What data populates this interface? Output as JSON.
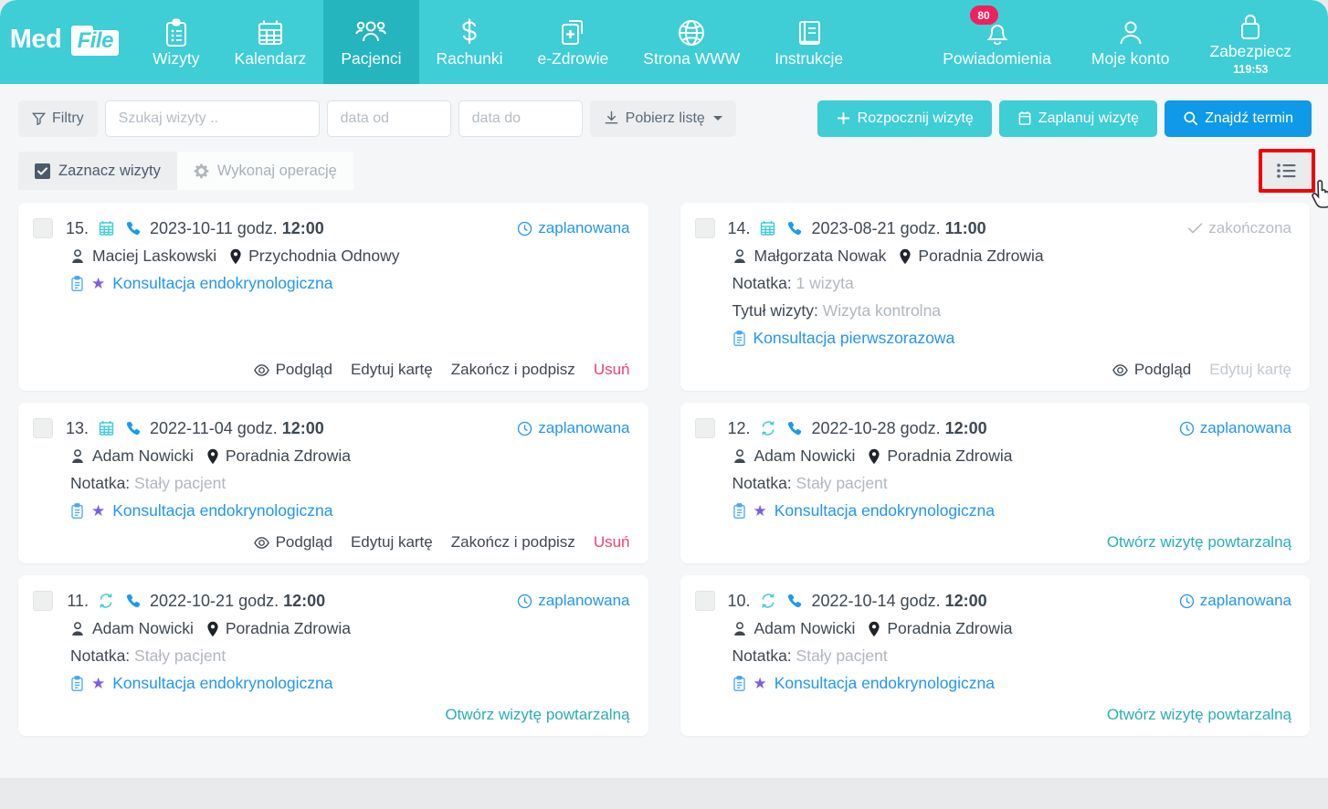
{
  "brand": {
    "med": "Med",
    "file": "File",
    "color": "#3fcdd6"
  },
  "nav": {
    "items": [
      {
        "label": "Wizyty",
        "icon": "clipboard-icon",
        "active": false
      },
      {
        "label": "Kalendarz",
        "icon": "calendar-icon",
        "active": false
      },
      {
        "label": "Pacjenci",
        "icon": "users-icon",
        "active": true
      },
      {
        "label": "Rachunki",
        "icon": "dollar-icon",
        "active": false
      },
      {
        "label": "e-Zdrowie",
        "icon": "medical-file-icon",
        "active": false
      },
      {
        "label": "Strona WWW",
        "icon": "globe-icon",
        "active": false
      },
      {
        "label": "Instrukcje",
        "icon": "book-icon",
        "active": false
      }
    ]
  },
  "header_right": {
    "notifications": {
      "label": "Powiadomienia",
      "icon": "bell-icon",
      "badge": "80",
      "badge_color": "#f01f5e"
    },
    "account": {
      "label": "Moje konto",
      "icon": "user-icon"
    },
    "secure": {
      "label": "Zabezpiecz",
      "icon": "lock-icon",
      "timer": "119:53"
    }
  },
  "toolbar": {
    "filters_label": "Filtry",
    "search_placeholder": "Szukaj wizyty ..",
    "search_value": "",
    "date_from_placeholder": "data od",
    "date_from_value": "",
    "date_to_placeholder": "data do",
    "date_to_value": "",
    "download_label": "Pobierz listę",
    "start_visit_label": "Rozpocznij wizytę",
    "plan_visit_label": "Zaplanuj wizytę",
    "find_slot_label": "Znajdź termin"
  },
  "toolbar2": {
    "select_visits_label": "Zaznacz wizyty",
    "run_operation_label": "Wykonaj operację",
    "view_toggle_icon": "list-view-icon",
    "view_toggle_highlight_color": "#f40000"
  },
  "labels": {
    "hour": "godz.",
    "note": "Notatka:",
    "visit_title": "Tytuł wizyty:"
  },
  "cards": [
    {
      "index": "15.",
      "type_icon": "calendar-icon",
      "channel_icon": "phone-icon",
      "date": "2023-10-11",
      "time": "12:00",
      "status": "zaplanowana",
      "status_kind": "planned",
      "patient": "Maciej Laskowski",
      "facility": "Przychodnia Odnowy",
      "note": null,
      "visit_title": null,
      "service": "Konsultacja endokrynologiczna",
      "service_star": true,
      "actions": [
        {
          "label": "Podgląd",
          "icon": "eye-icon",
          "kind": "normal"
        },
        {
          "label": "Edytuj kartę",
          "icon": null,
          "kind": "normal"
        },
        {
          "label": "Zakończ i podpisz",
          "icon": null,
          "kind": "normal"
        },
        {
          "label": "Usuń",
          "icon": null,
          "kind": "delete"
        }
      ],
      "size": "tall"
    },
    {
      "index": "14.",
      "type_icon": "calendar-icon",
      "channel_icon": "phone-icon",
      "date": "2023-08-21",
      "time": "11:00",
      "status": "zakończona",
      "status_kind": "done",
      "patient": "Małgorzata Nowak",
      "facility": "Poradnia Zdrowia",
      "note": "1 wizyta",
      "visit_title": "Wizyta kontrolna",
      "service": "Konsultacja pierwszorazowa",
      "service_star": false,
      "actions": [
        {
          "label": "Podgląd",
          "icon": "eye-icon",
          "kind": "normal"
        },
        {
          "label": "Edytuj kartę",
          "icon": null,
          "kind": "disabled"
        }
      ],
      "size": "tall"
    },
    {
      "index": "13.",
      "type_icon": "calendar-icon",
      "channel_icon": "phone-icon",
      "date": "2022-11-04",
      "time": "12:00",
      "status": "zaplanowana",
      "status_kind": "planned",
      "patient": "Adam Nowicki",
      "facility": "Poradnia Zdrowia",
      "note": "Stały pacjent",
      "visit_title": null,
      "service": "Konsultacja endokrynologiczna",
      "service_star": true,
      "actions": [
        {
          "label": "Podgląd",
          "icon": "eye-icon",
          "kind": "normal"
        },
        {
          "label": "Edytuj kartę",
          "icon": null,
          "kind": "normal"
        },
        {
          "label": "Zakończ i podpisz",
          "icon": null,
          "kind": "normal"
        },
        {
          "label": "Usuń",
          "icon": null,
          "kind": "delete"
        }
      ],
      "size": "short"
    },
    {
      "index": "12.",
      "type_icon": "recurring-icon",
      "channel_icon": "phone-icon",
      "date": "2022-10-28",
      "time": "12:00",
      "status": "zaplanowana",
      "status_kind": "planned",
      "patient": "Adam Nowicki",
      "facility": "Poradnia Zdrowia",
      "note": "Stały pacjent",
      "visit_title": null,
      "service": "Konsultacja endokrynologiczna",
      "service_star": true,
      "actions": [
        {
          "label": "Otwórz wizytę powtarzalną",
          "icon": null,
          "kind": "teal"
        }
      ],
      "size": "short"
    },
    {
      "index": "11.",
      "type_icon": "recurring-icon",
      "channel_icon": "phone-icon",
      "date": "2022-10-21",
      "time": "12:00",
      "status": "zaplanowana",
      "status_kind": "planned",
      "patient": "Adam Nowicki",
      "facility": "Poradnia Zdrowia",
      "note": "Stały pacjent",
      "visit_title": null,
      "service": "Konsultacja endokrynologiczna",
      "service_star": true,
      "actions": [
        {
          "label": "Otwórz wizytę powtarzalną",
          "icon": null,
          "kind": "teal"
        }
      ],
      "size": "short"
    },
    {
      "index": "10.",
      "type_icon": "recurring-icon",
      "channel_icon": "phone-icon",
      "date": "2022-10-14",
      "time": "12:00",
      "status": "zaplanowana",
      "status_kind": "planned",
      "patient": "Adam Nowicki",
      "facility": "Poradnia Zdrowia",
      "note": "Stały pacjent",
      "visit_title": null,
      "service": "Konsultacja endokrynologiczna",
      "service_star": true,
      "actions": [
        {
          "label": "Otwórz wizytę powtarzalną",
          "icon": null,
          "kind": "teal"
        }
      ],
      "size": "short"
    }
  ]
}
